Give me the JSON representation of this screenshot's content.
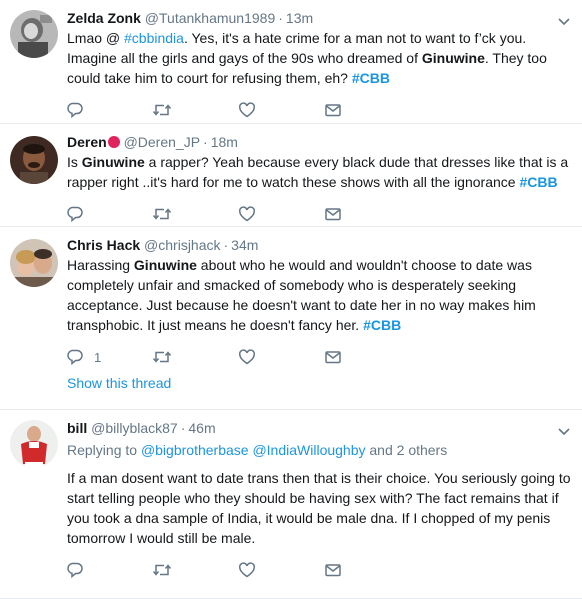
{
  "tweets": [
    {
      "name": "Zelda Zonk",
      "handle": "@Tutankhamun1989",
      "dot": "·",
      "time": "13m",
      "lines": [
        [
          "Lmao @ ",
          "#cbbindia",
          ".  Yes, it's a hate crime for a man not to want to f’ck you."
        ],
        [
          "Imagine all  the girls and gays of the 90s who dreamed of ",
          "Ginuwine",
          ". They too"
        ],
        [
          "could  take him to court for refusing them, eh? ",
          "#CBB"
        ]
      ],
      "reply_count": "",
      "retweet_count": "",
      "like_count": ""
    },
    {
      "name": "Deren",
      "handle": "@Deren_JP",
      "dot": "·",
      "time": "18m",
      "lines": [
        [
          "Is ",
          "Ginuwine",
          " a rapper? Yeah because every black dude that dresses like that is a"
        ],
        [
          "rapper right ..it's hard for me to watch these shows with all the ignorance ",
          "#CBB"
        ]
      ],
      "reply_count": "",
      "retweet_count": "",
      "like_count": ""
    },
    {
      "name": "Chris Hack",
      "handle": "@chrisjhack",
      "dot": "·",
      "time": "34m",
      "lines": [
        [
          "Harassing ",
          "Ginuwine",
          " about who he would and wouldn't choose to date was"
        ],
        [
          "completely unfair and smacked of somebody who is desperately seeking"
        ],
        [
          "acceptance. Just because he doesn't want to date her in no way makes him"
        ],
        [
          "transphobic. It just means he doesn't fancy her. ",
          "#CBB"
        ]
      ],
      "reply_count": "1",
      "retweet_count": "",
      "like_count": "",
      "show_thread": "Show this thread"
    },
    {
      "name": "bill",
      "handle": "@billyblack87",
      "dot": "·",
      "time": "46m",
      "replying_prefix": "Replying to ",
      "replying_user1": "@bigbrotherbase",
      "replying_user2": "@IndiaWilloughby",
      "replying_suffix": " and 2 others",
      "lines": [
        [
          "If a man dosent want to date trans then that is their choice. You seriously going to"
        ],
        [
          "start telling people who they should be having sex with? The fact remains that if"
        ],
        [
          "you took a dna sample of India, it would be male dna. If I chopped of my penis"
        ],
        [
          "tomorrow I would still be male."
        ]
      ],
      "reply_count": "",
      "retweet_count": "",
      "like_count": ""
    }
  ],
  "icons": {
    "reply": "reply-icon",
    "retweet": "retweet-icon",
    "like": "heart-icon",
    "dm": "envelope-icon",
    "more": "chevron-down-icon"
  },
  "colors": {
    "link": "#1b95e0",
    "secondary": "#657786",
    "text": "#14171a",
    "divider": "#e6ecf0",
    "badge": "#e0245e"
  }
}
